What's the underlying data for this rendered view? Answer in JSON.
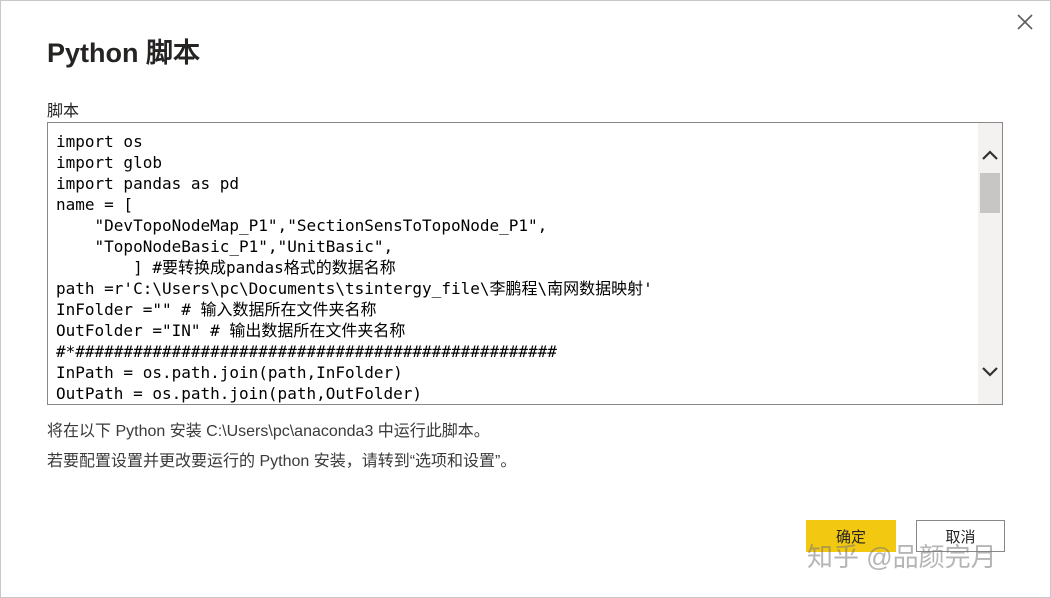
{
  "dialog": {
    "title": "Python 脚本",
    "script_label": "脚本",
    "close_icon": "close-icon"
  },
  "editor": {
    "lines": [
      "import os",
      "import glob",
      "import pandas as pd",
      "name = [",
      "    \"DevTopoNodeMap_P1\",\"SectionSensToTopoNode_P1\",",
      "    \"TopoNodeBasic_P1\",\"UnitBasic\",",
      "        ] #要转换成pandas格式的数据名称",
      "path =r'C:\\Users\\pc\\Documents\\tsintergy_file\\李鹏程\\南网数据映射'",
      "InFolder =\"\" # 输入数据所在文件夹名称",
      "OutFolder =\"IN\" # 输出数据所在文件夹名称",
      "#*##################################################",
      "InPath = os.path.join(path,InFolder)",
      "OutPath = os.path.join(path,OutFolder)"
    ],
    "scroll_up_icon": "chevron-up-icon",
    "scroll_down_icon": "chevron-down-icon"
  },
  "info": {
    "line1": "将在以下 Python 安装 C:\\Users\\pc\\anaconda3 中运行此脚本。",
    "line2": "若要配置设置并更改要运行的 Python 安装，请转到“选项和设置”。"
  },
  "buttons": {
    "ok": "确定",
    "cancel": "取消"
  },
  "watermark": "知乎 @品颜完月",
  "colors": {
    "accent": "#f2c811",
    "border": "#8a8886",
    "text": "#252423"
  }
}
